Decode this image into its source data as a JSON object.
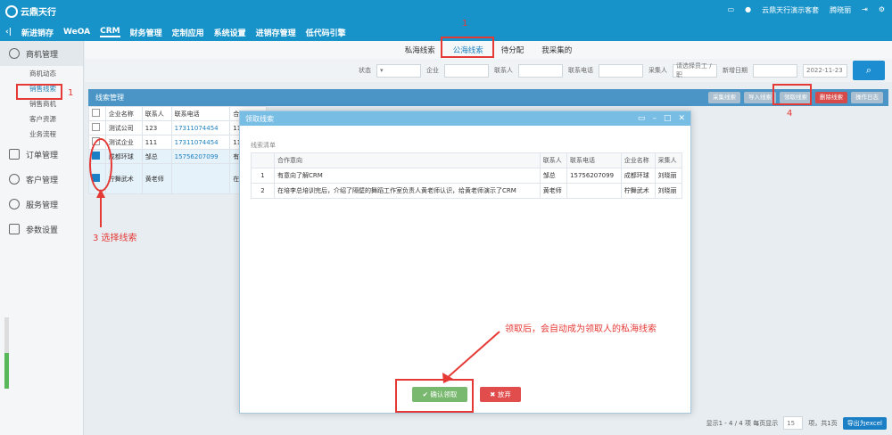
{
  "app": {
    "logo_text": "云鼎天行"
  },
  "topbar": {
    "user_company": "云鼎天行演示客套",
    "user_name": "腾晓丽"
  },
  "nav": [
    "新进销存",
    "WeOA",
    "CRM",
    "财务管理",
    "定制应用",
    "系统设置",
    "进销存管理",
    "低代码引擎"
  ],
  "sidebar": {
    "main1": "商机管理",
    "subs": [
      "商机动态",
      "销售线索",
      "销售商机",
      "客户资源",
      "业务流程"
    ],
    "items": [
      "订单管理",
      "客户管理",
      "服务管理",
      "参数设置"
    ]
  },
  "tabs": [
    "私海线索",
    "公海线索",
    "待分配",
    "我采集的"
  ],
  "search": {
    "labels": [
      "状态",
      "企业",
      "联系人",
      "联系电话",
      "采集人",
      "新增日期"
    ],
    "collector_placeholder": "请选择员工 /职",
    "date_end": "2022-11-23"
  },
  "grid": {
    "title": "线索管理",
    "actions": [
      "采集线索",
      "导入线索",
      "领取线索",
      "删除线索",
      "操作日志"
    ],
    "headers": [
      "企业名称",
      "联系人",
      "联系电话",
      "合作意"
    ],
    "rows": [
      {
        "company": "测试公司",
        "contact": "123",
        "phone": "17311074454",
        "extra": "11111"
      },
      {
        "company": "测试企业",
        "contact": "111",
        "phone": "17311074454",
        "extra": "11111"
      },
      {
        "company": "成都环球",
        "contact": "邹总",
        "phone": "15756207099",
        "extra": "有意向"
      },
      {
        "company": "柠舞武术",
        "contact": "黄老师",
        "phone": "",
        "extra": "在培李..."
      }
    ]
  },
  "footer": {
    "status": "显示1 - 4 / 4 项  每页显示",
    "page_size": "15",
    "page_info": "项，共1页",
    "export": "导出为excel"
  },
  "modal": {
    "title": "领取线索",
    "subtitle": "线索清单",
    "headers": [
      "",
      "合作意向",
      "联系人",
      "联系电话",
      "企业名称",
      "采集人"
    ],
    "rows": [
      [
        "1",
        "有意向了解CRM",
        "邹总",
        "15756207099",
        "成都环球",
        "刘晓丽"
      ],
      [
        "2",
        "在培李总培训完后，介绍了隔壁的舞蹈工作室负责人黄老师认识，给黄老师演示了CRM",
        "黄老师",
        "",
        "柠舞武术",
        "刘晓丽"
      ]
    ],
    "ok": "确认领取",
    "cancel": "放弃"
  },
  "annotations": {
    "a1": "1",
    "a2": "1",
    "a3": "3  选择线索",
    "a4": "4",
    "note": "领取后，会自动成为领取人的私海线索"
  }
}
